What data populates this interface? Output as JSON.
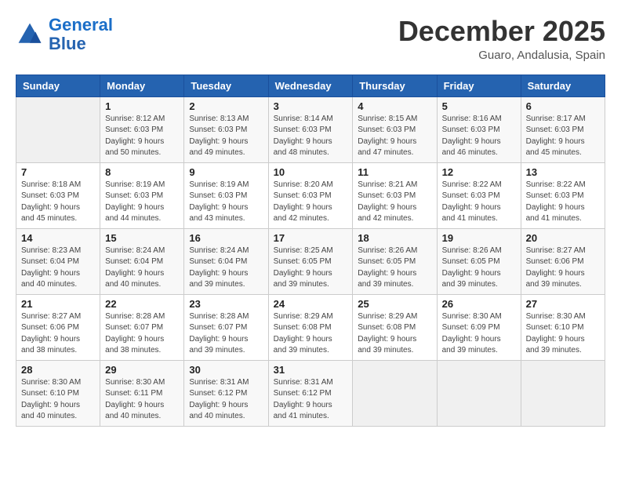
{
  "logo": {
    "line1": "General",
    "line2": "Blue"
  },
  "title": "December 2025",
  "subtitle": "Guaro, Andalusia, Spain",
  "header_days": [
    "Sunday",
    "Monday",
    "Tuesday",
    "Wednesday",
    "Thursday",
    "Friday",
    "Saturday"
  ],
  "weeks": [
    [
      {
        "day": "",
        "info": ""
      },
      {
        "day": "1",
        "info": "Sunrise: 8:12 AM\nSunset: 6:03 PM\nDaylight: 9 hours\nand 50 minutes."
      },
      {
        "day": "2",
        "info": "Sunrise: 8:13 AM\nSunset: 6:03 PM\nDaylight: 9 hours\nand 49 minutes."
      },
      {
        "day": "3",
        "info": "Sunrise: 8:14 AM\nSunset: 6:03 PM\nDaylight: 9 hours\nand 48 minutes."
      },
      {
        "day": "4",
        "info": "Sunrise: 8:15 AM\nSunset: 6:03 PM\nDaylight: 9 hours\nand 47 minutes."
      },
      {
        "day": "5",
        "info": "Sunrise: 8:16 AM\nSunset: 6:03 PM\nDaylight: 9 hours\nand 46 minutes."
      },
      {
        "day": "6",
        "info": "Sunrise: 8:17 AM\nSunset: 6:03 PM\nDaylight: 9 hours\nand 45 minutes."
      }
    ],
    [
      {
        "day": "7",
        "info": "Sunrise: 8:18 AM\nSunset: 6:03 PM\nDaylight: 9 hours\nand 45 minutes."
      },
      {
        "day": "8",
        "info": "Sunrise: 8:19 AM\nSunset: 6:03 PM\nDaylight: 9 hours\nand 44 minutes."
      },
      {
        "day": "9",
        "info": "Sunrise: 8:19 AM\nSunset: 6:03 PM\nDaylight: 9 hours\nand 43 minutes."
      },
      {
        "day": "10",
        "info": "Sunrise: 8:20 AM\nSunset: 6:03 PM\nDaylight: 9 hours\nand 42 minutes."
      },
      {
        "day": "11",
        "info": "Sunrise: 8:21 AM\nSunset: 6:03 PM\nDaylight: 9 hours\nand 42 minutes."
      },
      {
        "day": "12",
        "info": "Sunrise: 8:22 AM\nSunset: 6:03 PM\nDaylight: 9 hours\nand 41 minutes."
      },
      {
        "day": "13",
        "info": "Sunrise: 8:22 AM\nSunset: 6:03 PM\nDaylight: 9 hours\nand 41 minutes."
      }
    ],
    [
      {
        "day": "14",
        "info": "Sunrise: 8:23 AM\nSunset: 6:04 PM\nDaylight: 9 hours\nand 40 minutes."
      },
      {
        "day": "15",
        "info": "Sunrise: 8:24 AM\nSunset: 6:04 PM\nDaylight: 9 hours\nand 40 minutes."
      },
      {
        "day": "16",
        "info": "Sunrise: 8:24 AM\nSunset: 6:04 PM\nDaylight: 9 hours\nand 39 minutes."
      },
      {
        "day": "17",
        "info": "Sunrise: 8:25 AM\nSunset: 6:05 PM\nDaylight: 9 hours\nand 39 minutes."
      },
      {
        "day": "18",
        "info": "Sunrise: 8:26 AM\nSunset: 6:05 PM\nDaylight: 9 hours\nand 39 minutes."
      },
      {
        "day": "19",
        "info": "Sunrise: 8:26 AM\nSunset: 6:05 PM\nDaylight: 9 hours\nand 39 minutes."
      },
      {
        "day": "20",
        "info": "Sunrise: 8:27 AM\nSunset: 6:06 PM\nDaylight: 9 hours\nand 39 minutes."
      }
    ],
    [
      {
        "day": "21",
        "info": "Sunrise: 8:27 AM\nSunset: 6:06 PM\nDaylight: 9 hours\nand 38 minutes."
      },
      {
        "day": "22",
        "info": "Sunrise: 8:28 AM\nSunset: 6:07 PM\nDaylight: 9 hours\nand 38 minutes."
      },
      {
        "day": "23",
        "info": "Sunrise: 8:28 AM\nSunset: 6:07 PM\nDaylight: 9 hours\nand 39 minutes."
      },
      {
        "day": "24",
        "info": "Sunrise: 8:29 AM\nSunset: 6:08 PM\nDaylight: 9 hours\nand 39 minutes."
      },
      {
        "day": "25",
        "info": "Sunrise: 8:29 AM\nSunset: 6:08 PM\nDaylight: 9 hours\nand 39 minutes."
      },
      {
        "day": "26",
        "info": "Sunrise: 8:30 AM\nSunset: 6:09 PM\nDaylight: 9 hours\nand 39 minutes."
      },
      {
        "day": "27",
        "info": "Sunrise: 8:30 AM\nSunset: 6:10 PM\nDaylight: 9 hours\nand 39 minutes."
      }
    ],
    [
      {
        "day": "28",
        "info": "Sunrise: 8:30 AM\nSunset: 6:10 PM\nDaylight: 9 hours\nand 40 minutes."
      },
      {
        "day": "29",
        "info": "Sunrise: 8:30 AM\nSunset: 6:11 PM\nDaylight: 9 hours\nand 40 minutes."
      },
      {
        "day": "30",
        "info": "Sunrise: 8:31 AM\nSunset: 6:12 PM\nDaylight: 9 hours\nand 40 minutes."
      },
      {
        "day": "31",
        "info": "Sunrise: 8:31 AM\nSunset: 6:12 PM\nDaylight: 9 hours\nand 41 minutes."
      },
      {
        "day": "",
        "info": ""
      },
      {
        "day": "",
        "info": ""
      },
      {
        "day": "",
        "info": ""
      }
    ]
  ]
}
